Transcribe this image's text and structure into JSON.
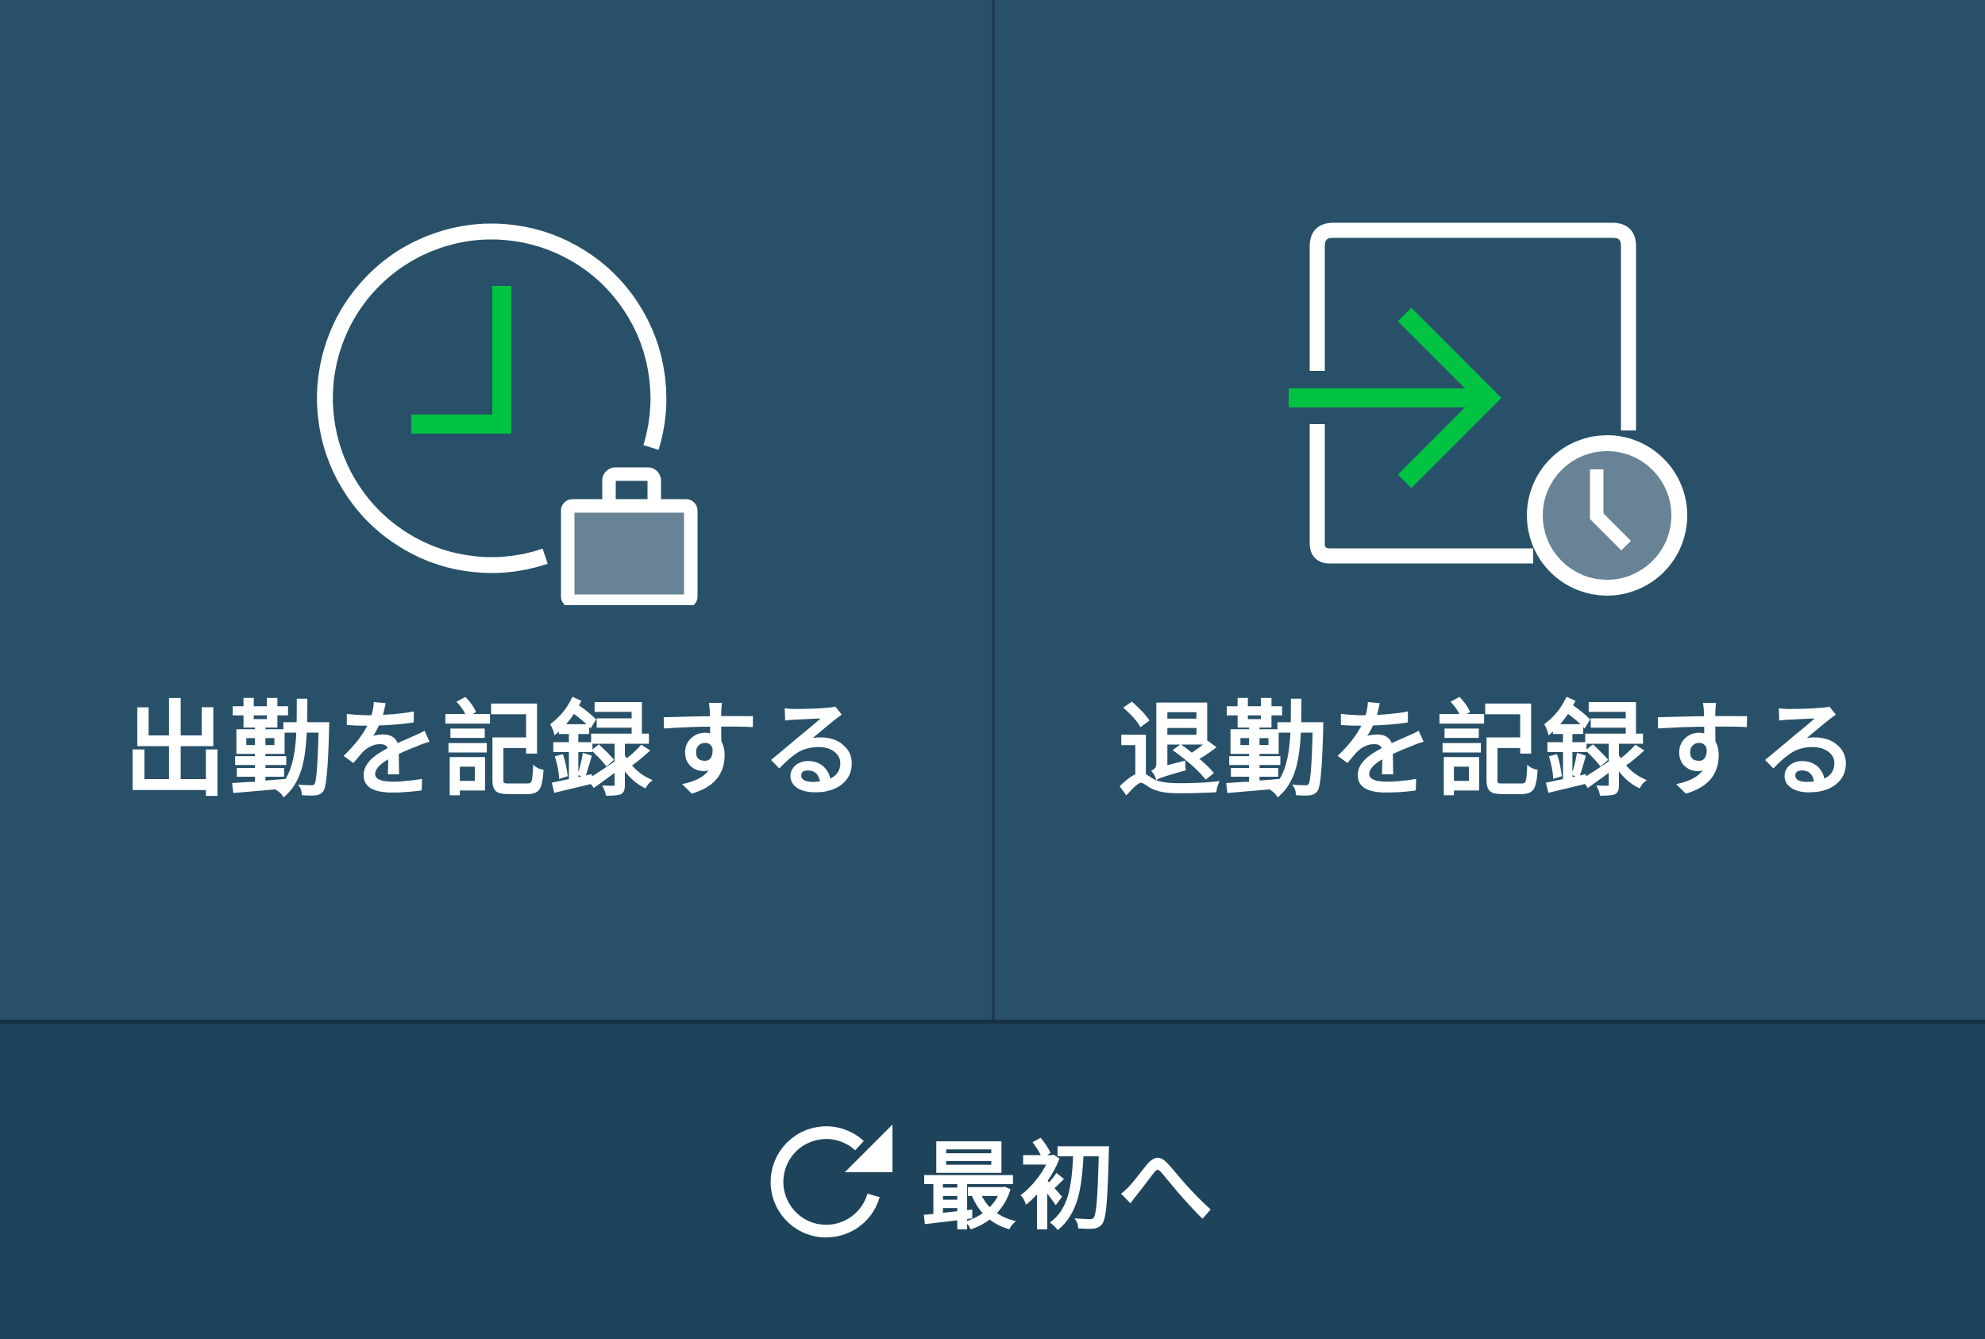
{
  "panels": {
    "clock_in": {
      "label": "出勤を記録する",
      "icon": "clock-briefcase-icon"
    },
    "clock_out": {
      "label": "退勤を記録する",
      "icon": "exit-clock-icon"
    }
  },
  "footer": {
    "reset_label": "最初へ",
    "reset_icon": "refresh-icon"
  },
  "colors": {
    "background": "#285169",
    "footer_background": "#1e445c",
    "accent_green": "#00c243",
    "icon_white": "#ffffff",
    "icon_fill_gray": "#678395"
  }
}
